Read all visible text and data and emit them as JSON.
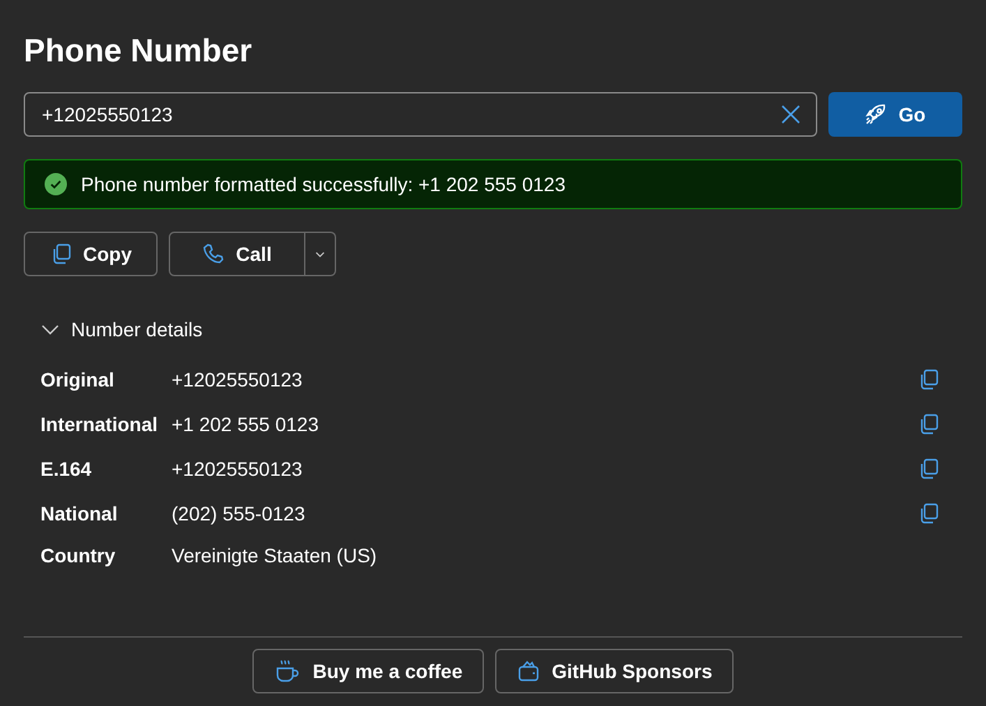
{
  "title": "Phone Number",
  "input": {
    "value": "+12025550123"
  },
  "go_button": "Go",
  "alert": {
    "kind": "success",
    "text": "Phone number formatted successfully: +1 202 555 0123"
  },
  "actions": {
    "copy": "Copy",
    "call": "Call"
  },
  "details": {
    "label": "Number details",
    "expanded": true,
    "rows": [
      {
        "label": "Original",
        "value": "+12025550123",
        "copyable": true
      },
      {
        "label": "International",
        "value": "+1 202 555 0123",
        "copyable": true
      },
      {
        "label": "E.164",
        "value": "+12025550123",
        "copyable": true
      },
      {
        "label": "National",
        "value": "(202) 555-0123",
        "copyable": true
      },
      {
        "label": "Country",
        "value": "Vereinigte Staaten (US)",
        "copyable": false
      }
    ]
  },
  "footer": [
    {
      "kind": "coffee",
      "label": "Buy me a coffee"
    },
    {
      "kind": "sponsor",
      "label": "GitHub Sponsors"
    }
  ]
}
